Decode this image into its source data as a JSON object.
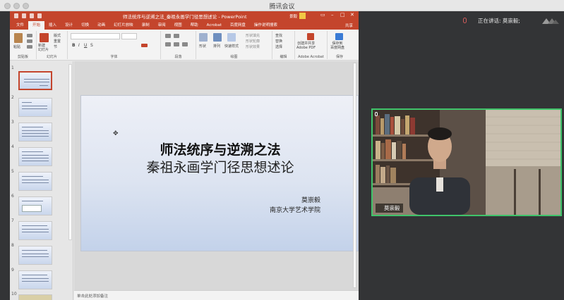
{
  "meeting_app": {
    "title": "腾讯会议"
  },
  "ppt": {
    "window_title": "师法统序与逆溯之法_秦祖永画学门径思想述论 - PowerPoint",
    "user": "景毅",
    "share_label": "共享",
    "tabs": [
      "文件",
      "开始",
      "插入",
      "设计",
      "切换",
      "动画",
      "幻灯片放映",
      "录制",
      "审阅",
      "视图",
      "帮助",
      "Acrobat",
      "百度网盘",
      "操作说明搜索"
    ],
    "active_tab": "开始",
    "groups": {
      "clipboard": "剪贴板",
      "slides": "幻灯片",
      "font": "字体",
      "paragraph": "段落",
      "drawing": "绘图",
      "editing": "编辑",
      "adobe": "Adobe Acrobat",
      "save": "保存"
    },
    "buttons": {
      "paste": "粘贴",
      "new_slide": "新建\n幻灯片",
      "layout": "版式",
      "reset": "重置",
      "section": "节",
      "shapes": "形状",
      "arrange": "排列",
      "quick_styles": "快速样式",
      "shape_fill": "形状填充",
      "shape_outline": "形状轮廓",
      "shape_effects": "形状效果",
      "find": "查找",
      "replace": "替换",
      "select": "选择",
      "create_share_pdf": "创建并共享\nAdobe PDF",
      "save_baidu": "保存到\n百度网盘"
    },
    "slide_numbers": [
      "1",
      "2",
      "3",
      "4",
      "5",
      "6",
      "7",
      "8",
      "9",
      "10"
    ],
    "current_slide": "1",
    "slide": {
      "title": "师法统序与逆溯之法",
      "subtitle": "秦祖永画学门径思想述论",
      "author": "莫崇毅",
      "affiliation": "南京大学艺术学院"
    },
    "notes_placeholder": "单击此处添加备注"
  },
  "speaker": {
    "label": "正在讲话: 莫崇毅;"
  },
  "video": {
    "participant_name": "莫崇毅",
    "border_color": "#3fc46a"
  },
  "colors": {
    "ppt_accent": "#c4452c",
    "meeting_bg": "#333436"
  }
}
